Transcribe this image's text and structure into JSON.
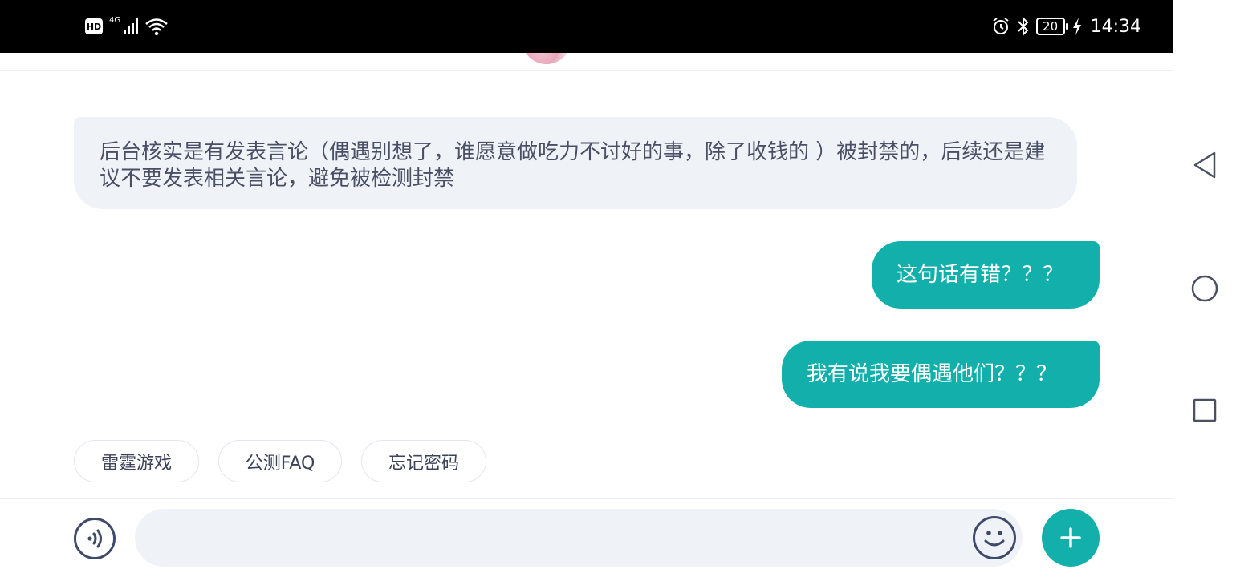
{
  "status_bar": {
    "badge": "HD",
    "network": "4G",
    "battery_level": "20",
    "time": "14:34",
    "icons": [
      "hd-icon",
      "signal-icon",
      "wifi-icon",
      "alarm-icon",
      "bluetooth-icon",
      "battery-icon",
      "charging-icon"
    ]
  },
  "messages": [
    {
      "from": "agent",
      "text": "后台核实是有发表言论（偶遇别想了，谁愿意做吃力不讨好的事，除了收钱的 ）被封禁的，后续还是建议不要发表相关言论，避免被检测封禁"
    },
    {
      "from": "user",
      "text": "这句话有错？？？"
    },
    {
      "from": "user",
      "text": "我有说我要偶遇他们？？？"
    }
  ],
  "quick_replies": [
    "雷霆游戏",
    "公测FAQ",
    "忘记密码"
  ],
  "input": {
    "value": "",
    "placeholder": ""
  },
  "colors": {
    "accent": "#13b0ab",
    "incoming_bubble": "#eff3f7",
    "icon_stroke": "#3f4a6a",
    "text": "#4a4f66"
  },
  "nav_icons": [
    "back-icon",
    "home-icon",
    "recent-apps-icon"
  ]
}
